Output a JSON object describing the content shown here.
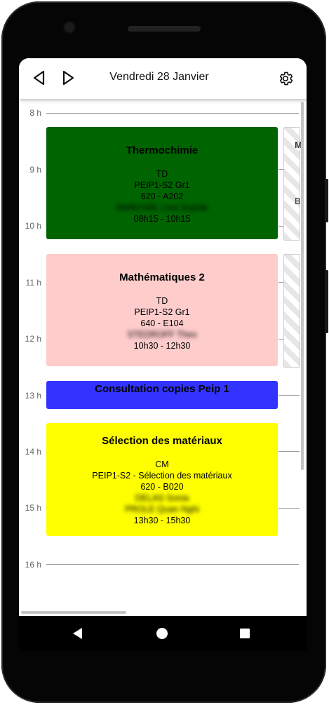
{
  "header": {
    "date": "Vendredi 28 Janvier",
    "prev_icon": "triangle-left-icon",
    "next_icon": "triangle-right-icon",
    "settings_icon": "gear-icon"
  },
  "hours": [
    "8 h",
    "9 h",
    "10 h",
    "11 h",
    "12 h",
    "13 h",
    "14 h",
    "15 h",
    "16 h"
  ],
  "events": [
    {
      "title": "Thermochimie",
      "type": "TD",
      "group": "PEIP1-S2 Gr1",
      "room": "620 - A202",
      "teacher": "MARCHAL Lina Sophie",
      "time": "08h15 - 10h15",
      "color": "#006400"
    },
    {
      "title": "Mathématiques 2",
      "type": "TD",
      "group": "PEIP1-S2 Gr1",
      "room": "640 - E104",
      "teacher": "STEDROFF Theo",
      "time": "10h30 - 12h30",
      "color": "#FFCCCC"
    },
    {
      "title": "Consultation copies Peip 1",
      "color": "#3333FF"
    },
    {
      "title": "Sélection des matériaux",
      "type": "CM",
      "group": "PEIP1-S2 - Sélection des matériaux",
      "room": "620 - B020",
      "teacher1": "DELAS Sonia",
      "teacher2": "PROLE Quan Nghi",
      "time": "13h30 - 15h30",
      "color": "#FFFF00"
    }
  ],
  "side_column": {
    "first_letter": "M",
    "second_letter": "B"
  },
  "system_nav": {
    "back_icon": "back-triangle-icon",
    "home_icon": "home-circle-icon",
    "recents_icon": "recents-square-icon"
  }
}
